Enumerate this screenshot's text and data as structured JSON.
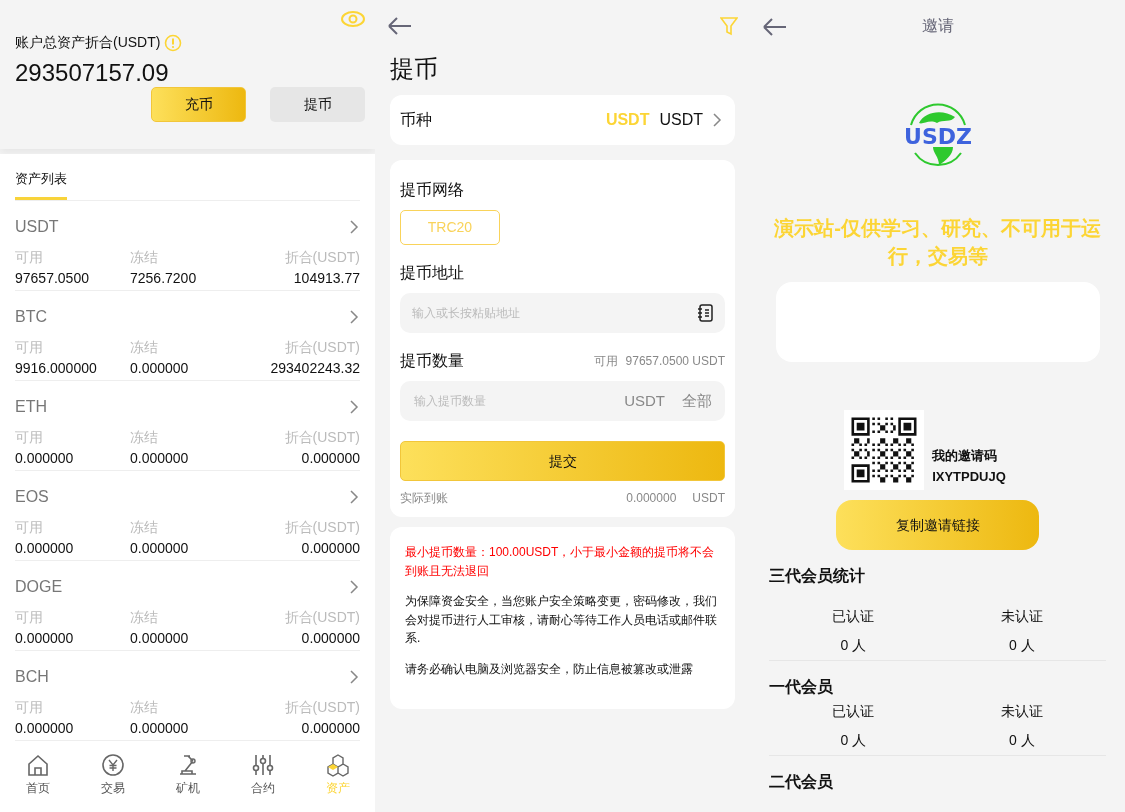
{
  "assets_panel": {
    "total_label": "账户总资产折合(USDT)",
    "total": "293507157.09",
    "buttons": [
      {
        "label": "充币",
        "kind": "primary"
      },
      {
        "label": "提币",
        "kind": "secondary"
      }
    ],
    "tabs": [
      {
        "label": "资产列表",
        "selected": true
      }
    ],
    "assets": [
      {
        "name": "USDT",
        "available_label": "可用",
        "available": "97657.0500",
        "frozen_label": "冻结",
        "frozen": "7256.7200",
        "value_label": "折合(USDT)",
        "value": "104913.77"
      },
      {
        "name": "BTC",
        "available_label": "可用",
        "available": "9916.000000",
        "frozen_label": "冻结",
        "frozen": "0.000000",
        "value_label": "折合(USDT)",
        "value": "293402243.32"
      },
      {
        "name": "ETH",
        "available_label": "可用",
        "available": "0.000000",
        "frozen_label": "冻结",
        "frozen": "0.000000",
        "value_label": "折合(USDT)",
        "value": "0.000000"
      },
      {
        "name": "EOS",
        "available_label": "可用",
        "available": "0.000000",
        "frozen_label": "冻结",
        "frozen": "0.000000",
        "value_label": "折合(USDT)",
        "value": "0.000000"
      },
      {
        "name": "DOGE",
        "available_label": "可用",
        "available": "0.000000",
        "frozen_label": "冻结",
        "frozen": "0.000000",
        "value_label": "折合(USDT)",
        "value": "0.000000"
      },
      {
        "name": "BCH",
        "available_label": "可用",
        "available": "0.000000",
        "frozen_label": "冻结",
        "frozen": "0.000000",
        "value_label": "折合(USDT)",
        "value": "0.000000"
      }
    ],
    "bottom_nav": [
      {
        "label": "首页",
        "selected": false
      },
      {
        "label": "交易",
        "selected": false
      },
      {
        "label": "矿机",
        "selected": false
      },
      {
        "label": "合约",
        "selected": false
      },
      {
        "label": "资产",
        "selected": true
      }
    ]
  },
  "withdraw_panel": {
    "title": "提币",
    "currency_label": "币种",
    "currency_highlight": "USDT",
    "currency_value": "USDT",
    "network_label": "提币网络",
    "networks": [
      {
        "label": "TRC20",
        "selected": true
      }
    ],
    "address_label": "提币地址",
    "address_placeholder": "输入或长按粘贴地址",
    "amount_label": "提币数量",
    "available_label": "可用",
    "available": "97657.0500 USDT",
    "amount_placeholder": "输入提币数量",
    "amount_unit": "USDT",
    "all_button": "全部",
    "submit": "提交",
    "received_label": "实际到账",
    "received_value": "0.000000",
    "received_unit": "USDT",
    "notes": [
      {
        "kind": "warning",
        "text": "最小提币数量：100.00USDT，小于最小金额的提币将不会到账且无法退回"
      },
      {
        "kind": "plain",
        "text": "为保障资金安全，当您账户安全策略变更，密码修改，我们会对提币进行人工审核，请耐心等待工作人员电话或邮件联系."
      },
      {
        "kind": "plain",
        "text": "请务必确认电脑及浏览器安全，防止信息被篡改或泄露"
      }
    ]
  },
  "invite_panel": {
    "title": "邀请",
    "logo_text": "USDZ",
    "notice": "演示站-仅供学习、研究、不可用于运行，交易等",
    "code_label": "我的邀请码",
    "code": "IXYTPDUJQ",
    "copy_button": "复制邀请链接",
    "stats": [
      {
        "title": "三代会员统计",
        "verified_label": "已认证",
        "verified": "0 人",
        "unverified_label": "未认证",
        "unverified": "0 人"
      },
      {
        "title": "一代会员",
        "verified_label": "已认证",
        "verified": "0 人",
        "unverified_label": "未认证",
        "unverified": "0 人"
      },
      {
        "title": "二代会员"
      }
    ]
  }
}
